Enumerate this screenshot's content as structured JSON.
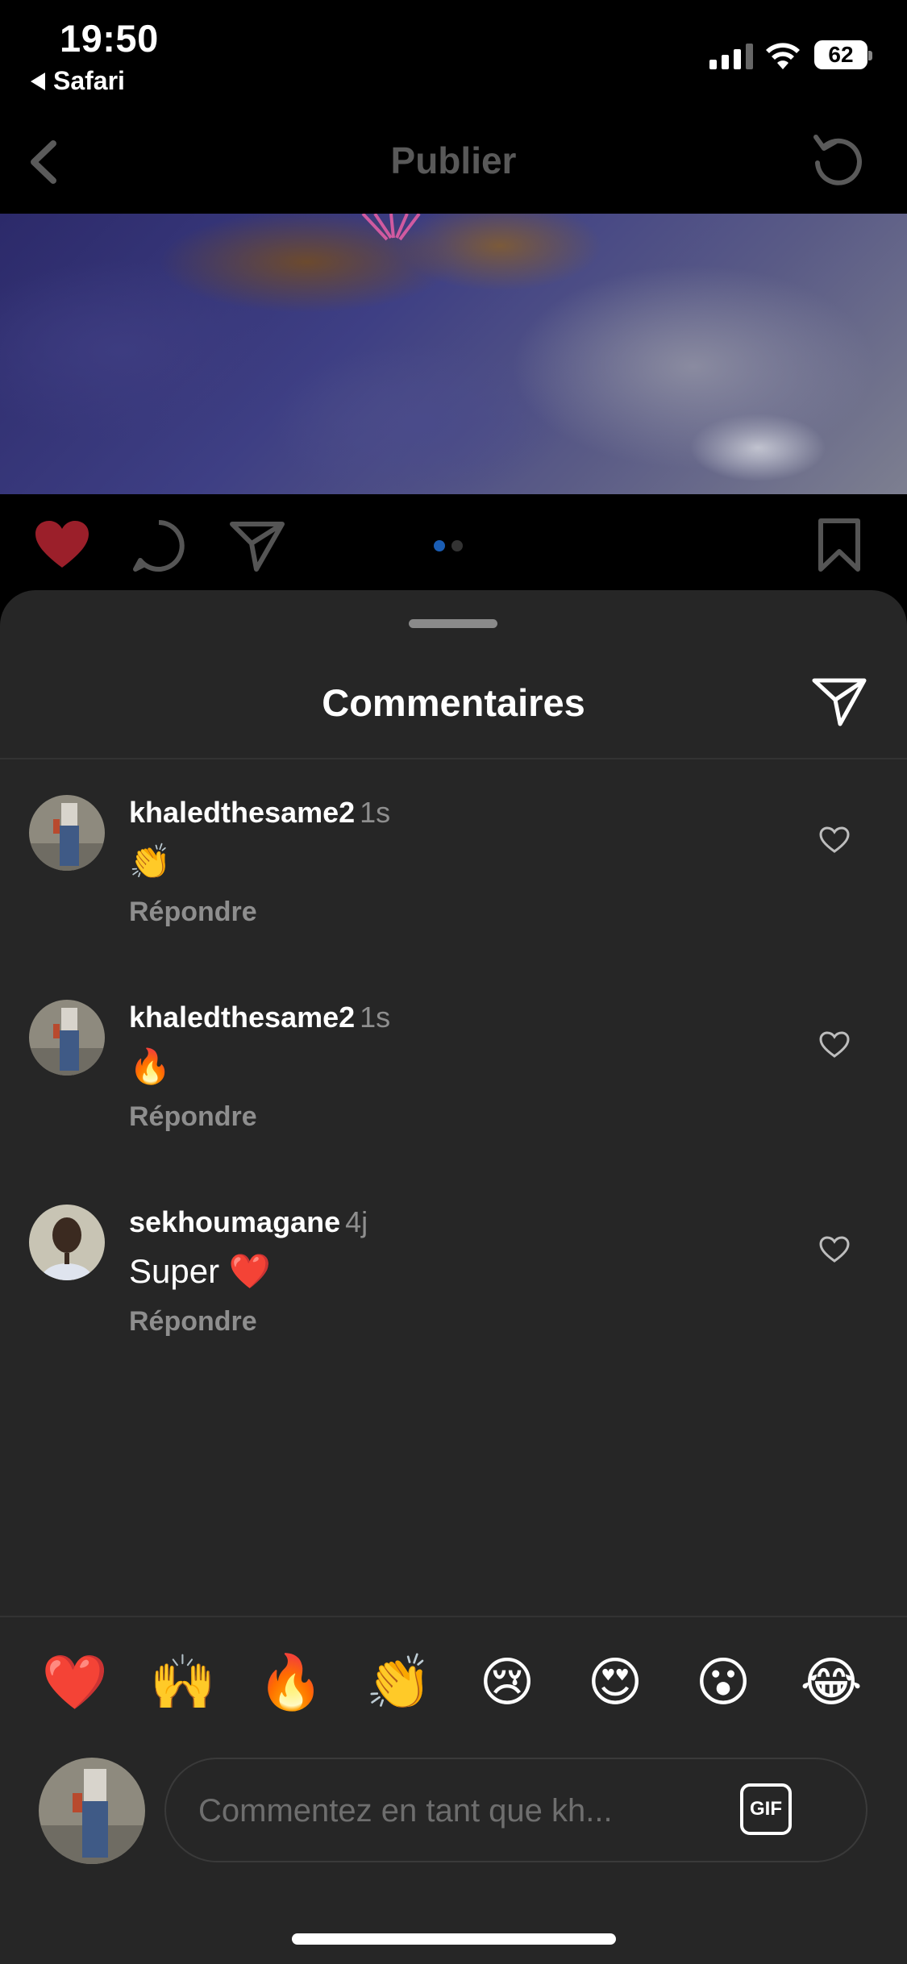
{
  "status_bar": {
    "time": "19:50",
    "back_app": "Safari",
    "battery": "62"
  },
  "nav": {
    "title": "Publier"
  },
  "post": {
    "image_dots": 2,
    "active_dot": 1
  },
  "comments_sheet": {
    "title": "Commentaires",
    "comments": [
      {
        "username": "khaledthesame2",
        "time": "1s",
        "text": "👏",
        "reply_label": "Répondre"
      },
      {
        "username": "khaledthesame2",
        "time": "1s",
        "text": "🔥",
        "reply_label": "Répondre"
      },
      {
        "username": "sekhoumagane",
        "time": "4j",
        "text": "Super ❤️",
        "reply_label": "Répondre"
      }
    ]
  },
  "emoji_bar": [
    "❤️",
    "🙌",
    "🔥",
    "👏",
    "😢",
    "😍",
    "😮",
    "😂"
  ],
  "composer": {
    "placeholder": "Commentez en tant que kh...",
    "gif_label": "GIF"
  },
  "colors": {
    "sheet_bg": "#262626",
    "liked_heart": "#9b1f2a",
    "muted_text": "#8e8e8e",
    "active_dot": "#1a5db4"
  }
}
